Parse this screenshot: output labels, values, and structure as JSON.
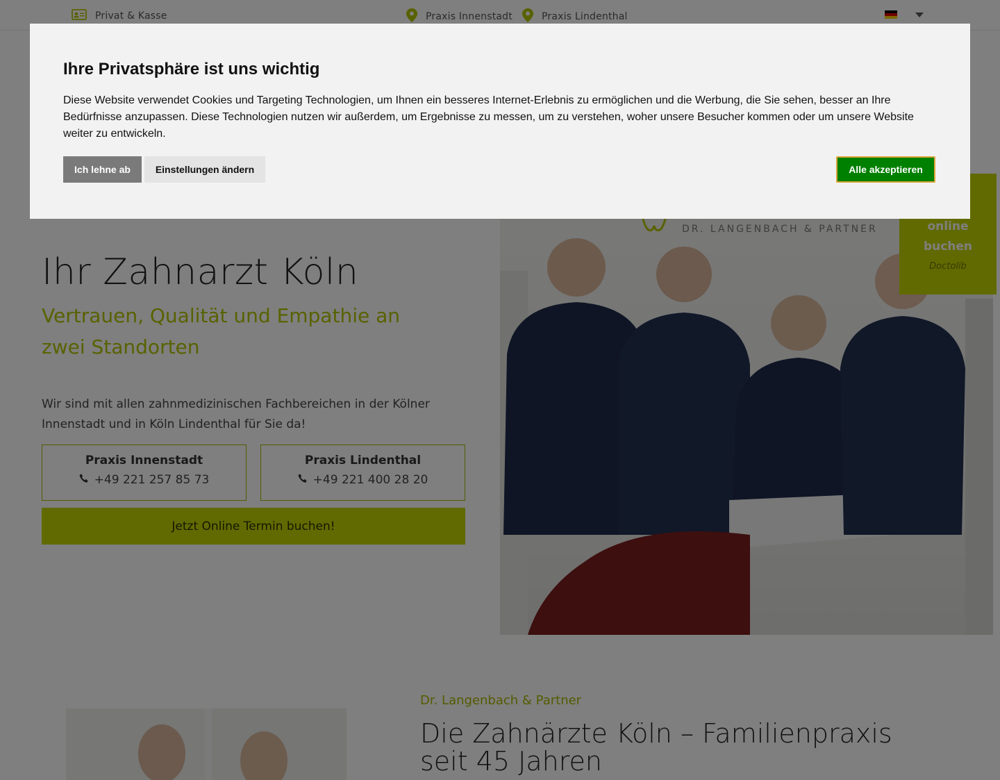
{
  "topbar": {
    "private_label": "Privat & Kasse",
    "location1": "Praxis Innenstadt",
    "location2": "Praxis Lindenthal",
    "flag_colors": [
      "#000000",
      "#dd0000",
      "#ffce00"
    ]
  },
  "hero": {
    "title": "Ihr Zahnarzt Köln",
    "subtitle": "Vertrauen, Qualität und Empathie an zwei Standorten",
    "text": "Wir sind mit allen zahnmedizinischen Fachbereichen in der Kölner Innenstadt und in Köln Lindenthal für Sie da!",
    "practices": [
      {
        "name": "Praxis Innenstadt",
        "phone": "+49 221 257 85 73"
      },
      {
        "name": "Praxis Lindenthal",
        "phone": "+49 221 400 28 20"
      }
    ],
    "cta": "Jetzt Online Termin buchen!",
    "brand": "DR. LANGENBACH & PARTNER"
  },
  "booking": {
    "line1": "online",
    "line2": "buchen",
    "provider": "Doctolib"
  },
  "about": {
    "eyebrow": "Dr. Langenbach & Partner",
    "title": "Die Zahnärzte Köln – Familienpraxis seit 45 Jahren"
  },
  "cookie": {
    "title": "Ihre Privatsphäre ist uns wichtig",
    "body": "Diese Website verwendet Cookies und Targeting Technologien, um Ihnen ein besseres Internet-Erlebnis zu ermöglichen und die Werbung, die Sie sehen, besser an Ihre Bedürfnisse anzupassen. Diese Technologien nutzen wir außerdem, um Ergebnisse zu messen, um zu verstehen, woher unsere Besucher kommen oder um unsere Website weiter zu entwickeln.",
    "decline": "Ich lehne ab",
    "settings": "Einstellungen ändern",
    "accept": "Alle akzeptieren"
  },
  "colors": {
    "accent": "#c3d400",
    "accent_text": "#b3c400",
    "accept_green": "#008000",
    "overlay": "rgba(0,0,0,0.5)"
  }
}
